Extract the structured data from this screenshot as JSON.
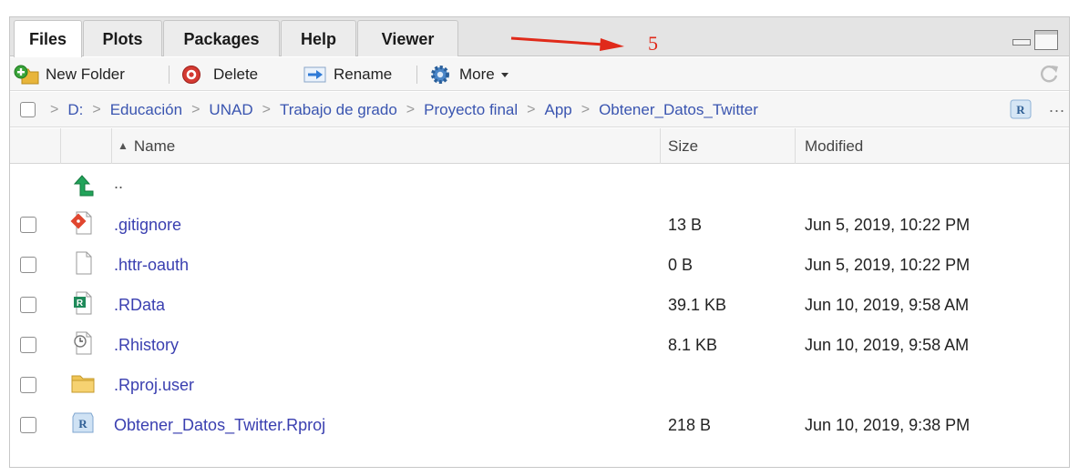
{
  "tabs": [
    {
      "label": "Files",
      "active": true
    },
    {
      "label": "Plots",
      "active": false
    },
    {
      "label": "Packages",
      "active": false
    },
    {
      "label": "Help",
      "active": false
    },
    {
      "label": "Viewer",
      "active": false
    }
  ],
  "annotation": {
    "number": "5",
    "color": "#e02a1a"
  },
  "toolbar": {
    "new_folder": "New Folder",
    "delete": "Delete",
    "rename": "Rename",
    "more": "More"
  },
  "breadcrumb": [
    "D:",
    "Educación",
    "UNAD",
    "Trabajo de grado",
    "Proyecto final",
    "App",
    "Obtener_Datos_Twitter"
  ],
  "path_more": "...",
  "columns": {
    "name": "Name",
    "size": "Size",
    "modified": "Modified"
  },
  "parent_row": {
    "name": ".."
  },
  "files": [
    {
      "name": ".gitignore",
      "size": "13 B",
      "modified": "Jun 5, 2019, 10:22 PM",
      "icon": "git-file-icon"
    },
    {
      "name": ".httr-oauth",
      "size": "0 B",
      "modified": "Jun 5, 2019, 10:22 PM",
      "icon": "blank-file-icon"
    },
    {
      "name": ".RData",
      "size": "39.1 KB",
      "modified": "Jun 10, 2019, 9:58 AM",
      "icon": "rdata-file-icon"
    },
    {
      "name": ".Rhistory",
      "size": "8.1 KB",
      "modified": "Jun 10, 2019, 9:58 AM",
      "icon": "history-file-icon"
    },
    {
      "name": ".Rproj.user",
      "size": "",
      "modified": "",
      "icon": "folder-icon"
    },
    {
      "name": "Obtener_Datos_Twitter.Rproj",
      "size": "218 B",
      "modified": "Jun 10, 2019, 9:38 PM",
      "icon": "rproj-file-icon"
    }
  ],
  "colors": {
    "link": "#3a3fb0",
    "breadcrumb": "#3a55b0",
    "tabbar": "#e4e4e4"
  }
}
